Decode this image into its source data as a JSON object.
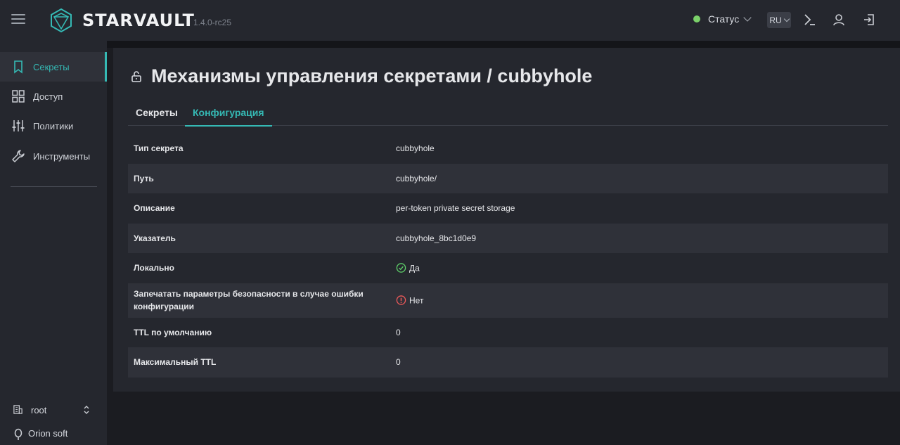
{
  "app": {
    "name": "STARVAULT",
    "version": "1.4.0-rc25",
    "status_label": "Статус",
    "status_color": "#7bd16a",
    "lang": "RU",
    "accent": "#35b9b4"
  },
  "sidebar": {
    "items": [
      {
        "label": "Секреты",
        "icon": "bookmark-icon",
        "active": true
      },
      {
        "label": "Доступ",
        "icon": "grid-icon"
      },
      {
        "label": "Политики",
        "icon": "sliders-icon"
      },
      {
        "label": "Инструменты",
        "icon": "wrench-icon"
      }
    ],
    "namespace": "root",
    "org": "Orion soft"
  },
  "page": {
    "title": "Механизмы управления секретами / cubbyhole",
    "tabs": [
      {
        "label": "Секреты"
      },
      {
        "label": "Конфигурация",
        "active": true
      }
    ]
  },
  "config": [
    {
      "key": "Тип секрета",
      "value": "cubbyhole"
    },
    {
      "key": "Путь",
      "value": "cubbyhole/"
    },
    {
      "key": "Описание",
      "value": "per-token private secret storage"
    },
    {
      "key": "Указатель",
      "value": "cubbyhole_8bc1d0e9"
    },
    {
      "key": "Локально",
      "value": "Да",
      "icon": "check-circle-icon",
      "icon_color": "#5fd16a"
    },
    {
      "key": "Запечатать параметры безопасности в случае ошибки конфигурации",
      "value": "Нет",
      "icon": "alert-circle-icon",
      "icon_color": "#f05a5a"
    },
    {
      "key": "TTL по умолчанию",
      "value": "0"
    },
    {
      "key": "Максимальный TTL",
      "value": "0"
    }
  ]
}
